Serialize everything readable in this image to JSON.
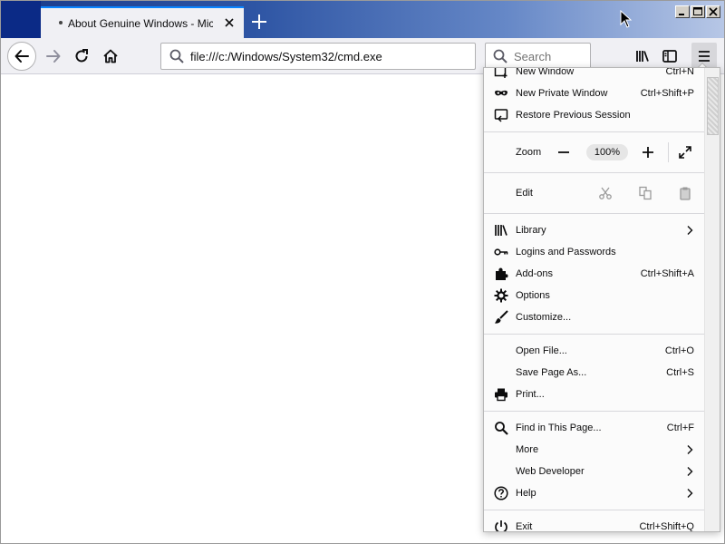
{
  "tab": {
    "title": "About Genuine Windows - Microsoft"
  },
  "toolbar": {
    "url": "file:///c:/Windows/System32/cmd.exe",
    "search_placeholder": "Search"
  },
  "menu": {
    "group1": [
      {
        "label": "New Window",
        "shortcut": "Ctrl+N",
        "icon": "new-window-icon"
      },
      {
        "label": "New Private Window",
        "shortcut": "Ctrl+Shift+P",
        "icon": "private-mask-icon"
      },
      {
        "label": "Restore Previous Session",
        "shortcut": "",
        "icon": "restore-session-icon"
      }
    ],
    "zoom": {
      "label": "Zoom",
      "value": "100%"
    },
    "edit": {
      "label": "Edit"
    },
    "group2": [
      {
        "label": "Library",
        "shortcut": "",
        "icon": "library-icon",
        "submenu": true
      },
      {
        "label": "Logins and Passwords",
        "shortcut": "",
        "icon": "key-icon"
      },
      {
        "label": "Add-ons",
        "shortcut": "Ctrl+Shift+A",
        "icon": "puzzle-icon"
      },
      {
        "label": "Options",
        "shortcut": "",
        "icon": "gear-icon"
      },
      {
        "label": "Customize...",
        "shortcut": "",
        "icon": "paintbrush-icon"
      }
    ],
    "group3": [
      {
        "label": "Open File...",
        "shortcut": "Ctrl+O"
      },
      {
        "label": "Save Page As...",
        "shortcut": "Ctrl+S"
      },
      {
        "label": "Print...",
        "shortcut": "",
        "icon": "printer-icon"
      }
    ],
    "group4": [
      {
        "label": "Find in This Page...",
        "shortcut": "Ctrl+F",
        "icon": "search-icon"
      },
      {
        "label": "More",
        "submenu": true
      },
      {
        "label": "Web Developer",
        "submenu": true
      },
      {
        "label": "Help",
        "icon": "help-icon",
        "submenu": true
      }
    ],
    "exit": {
      "label": "Exit",
      "shortcut": "Ctrl+Shift+Q",
      "icon": "power-icon"
    }
  },
  "colors": {
    "accent": "#0a84ff",
    "titlebar_start": "#1b3b8a",
    "toolbar_bg": "#f0f0f4"
  }
}
